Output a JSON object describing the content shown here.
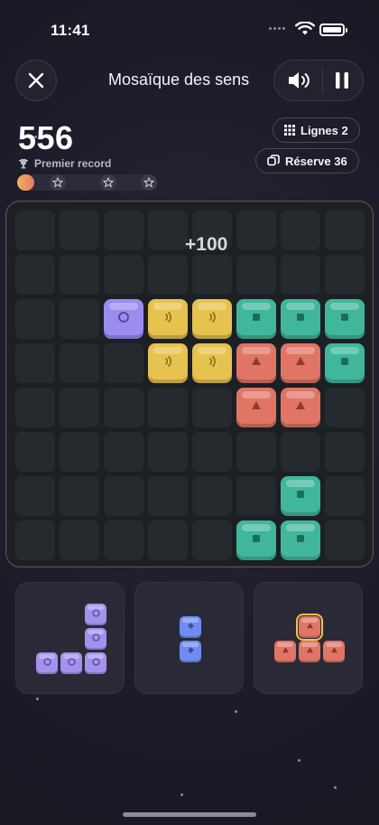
{
  "status_bar": {
    "time": "11:41"
  },
  "header": {
    "title": "Mosaïque des sens",
    "close_icon": "close-icon",
    "sound_icon": "speaker-icon",
    "pause_icon": "pause-icon"
  },
  "score": {
    "value": "556",
    "record_label": "Premier record",
    "progress_fraction": 0.12
  },
  "badges": {
    "lines_label": "Lignes 2",
    "reserve_label": "Réserve 36"
  },
  "board": {
    "columns": 8,
    "rows": 8,
    "combo_text": "+100",
    "tiles": [
      {
        "r": 2,
        "c": 2,
        "color": "purple",
        "symbol": "circle"
      },
      {
        "r": 2,
        "c": 3,
        "color": "yellow",
        "symbol": "sound"
      },
      {
        "r": 2,
        "c": 4,
        "color": "yellow",
        "symbol": "sound"
      },
      {
        "r": 2,
        "c": 5,
        "color": "teal",
        "symbol": "square"
      },
      {
        "r": 2,
        "c": 6,
        "color": "teal",
        "symbol": "square"
      },
      {
        "r": 2,
        "c": 7,
        "color": "teal",
        "symbol": "square"
      },
      {
        "r": 3,
        "c": 3,
        "color": "yellow",
        "symbol": "sound"
      },
      {
        "r": 3,
        "c": 4,
        "color": "yellow",
        "symbol": "sound"
      },
      {
        "r": 3,
        "c": 5,
        "color": "coral",
        "symbol": "triangle"
      },
      {
        "r": 3,
        "c": 6,
        "color": "coral",
        "symbol": "triangle"
      },
      {
        "r": 3,
        "c": 7,
        "color": "teal",
        "symbol": "square"
      },
      {
        "r": 4,
        "c": 5,
        "color": "coral",
        "symbol": "triangle"
      },
      {
        "r": 4,
        "c": 6,
        "color": "coral",
        "symbol": "triangle"
      },
      {
        "r": 6,
        "c": 6,
        "color": "teal",
        "symbol": "square"
      },
      {
        "r": 7,
        "c": 5,
        "color": "teal",
        "symbol": "square"
      },
      {
        "r": 7,
        "c": 6,
        "color": "teal",
        "symbol": "square"
      }
    ]
  },
  "pieces": [
    {
      "color": "purple",
      "symbol": "circle",
      "cells": [
        [
          0,
          2
        ],
        [
          1,
          2
        ],
        [
          2,
          0
        ],
        [
          2,
          1
        ],
        [
          2,
          2
        ]
      ]
    },
    {
      "color": "blue",
      "symbol": "diamond",
      "cells": [
        [
          0,
          0
        ],
        [
          1,
          0
        ]
      ]
    },
    {
      "color": "coral",
      "symbol": "triangle",
      "selected_cell": 0,
      "cells": [
        [
          0,
          1
        ],
        [
          1,
          0
        ],
        [
          1,
          1
        ],
        [
          1,
          2
        ]
      ]
    }
  ],
  "colors": {
    "purple": "#9b8cf0",
    "yellow": "#e6c24f",
    "teal": "#40b79b",
    "coral": "#e07566",
    "blue": "#6f8cf2",
    "accent": "#f0b35a"
  }
}
